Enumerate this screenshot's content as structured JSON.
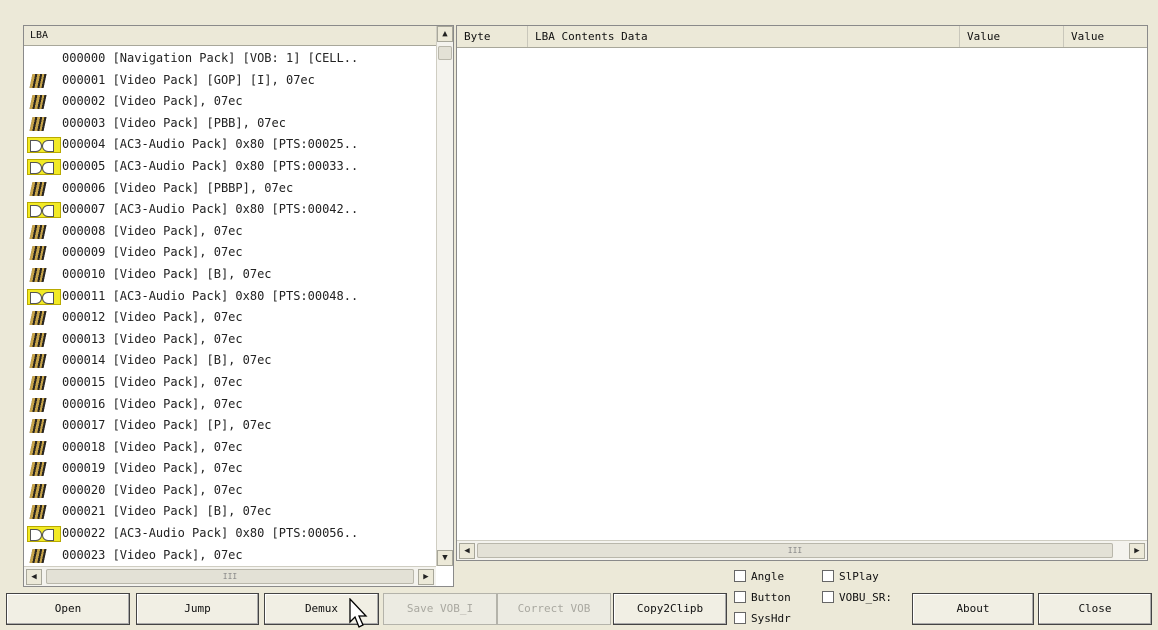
{
  "left_panel": {
    "header": "LBA",
    "hscroll_grip": "III",
    "rows": [
      {
        "icon": "none",
        "text": "000000 [Navigation Pack] [VOB: 1] [CELL.."
      },
      {
        "icon": "video",
        "text": "000001 [Video Pack] [GOP] [I], 07ec"
      },
      {
        "icon": "video",
        "text": "000002 [Video Pack], 07ec"
      },
      {
        "icon": "video",
        "text": "000003 [Video Pack] [PBB], 07ec"
      },
      {
        "icon": "audio",
        "text": "000004 [AC3-Audio Pack] 0x80 [PTS:00025.."
      },
      {
        "icon": "audio",
        "text": "000005 [AC3-Audio Pack] 0x80 [PTS:00033.."
      },
      {
        "icon": "video",
        "text": "000006 [Video Pack] [PBBP], 07ec"
      },
      {
        "icon": "audio",
        "text": "000007 [AC3-Audio Pack] 0x80 [PTS:00042.."
      },
      {
        "icon": "video",
        "text": "000008 [Video Pack], 07ec"
      },
      {
        "icon": "video",
        "text": "000009 [Video Pack], 07ec"
      },
      {
        "icon": "video",
        "text": "000010 [Video Pack] [B], 07ec"
      },
      {
        "icon": "audio",
        "text": "000011 [AC3-Audio Pack] 0x80 [PTS:00048.."
      },
      {
        "icon": "video",
        "text": "000012 [Video Pack], 07ec"
      },
      {
        "icon": "video",
        "text": "000013 [Video Pack], 07ec"
      },
      {
        "icon": "video",
        "text": "000014 [Video Pack] [B], 07ec"
      },
      {
        "icon": "video",
        "text": "000015 [Video Pack], 07ec"
      },
      {
        "icon": "video",
        "text": "000016 [Video Pack], 07ec"
      },
      {
        "icon": "video",
        "text": "000017 [Video Pack] [P], 07ec"
      },
      {
        "icon": "video",
        "text": "000018 [Video Pack], 07ec"
      },
      {
        "icon": "video",
        "text": "000019 [Video Pack], 07ec"
      },
      {
        "icon": "video",
        "text": "000020 [Video Pack], 07ec"
      },
      {
        "icon": "video",
        "text": "000021 [Video Pack] [B], 07ec"
      },
      {
        "icon": "audio",
        "text": "000022 [AC3-Audio Pack] 0x80 [PTS:00056.."
      },
      {
        "icon": "video",
        "text": "000023 [Video Pack], 07ec"
      }
    ]
  },
  "right_panel": {
    "columns": [
      "Byte",
      "LBA Contents Data",
      "Value",
      "Value"
    ],
    "hscroll_grip": "III"
  },
  "buttons": {
    "open": "Open",
    "jump": "Jump",
    "demux": "Demux",
    "save_vob": "Save VOB_I",
    "correct_vob": "Correct VOB",
    "copy2clipb": "Copy2Clipb",
    "about": "About",
    "close": "Close"
  },
  "checkboxes": {
    "angle": "Angle",
    "button": "Button",
    "sysHdr": "SysHdr",
    "slplay": "SlPlay",
    "vobu_sr": "VOBU_SR:"
  },
  "colors": {
    "window_bg": "#ece9d8",
    "audio_icon": "#f2ea25",
    "video_icon": "#c7a44a"
  }
}
